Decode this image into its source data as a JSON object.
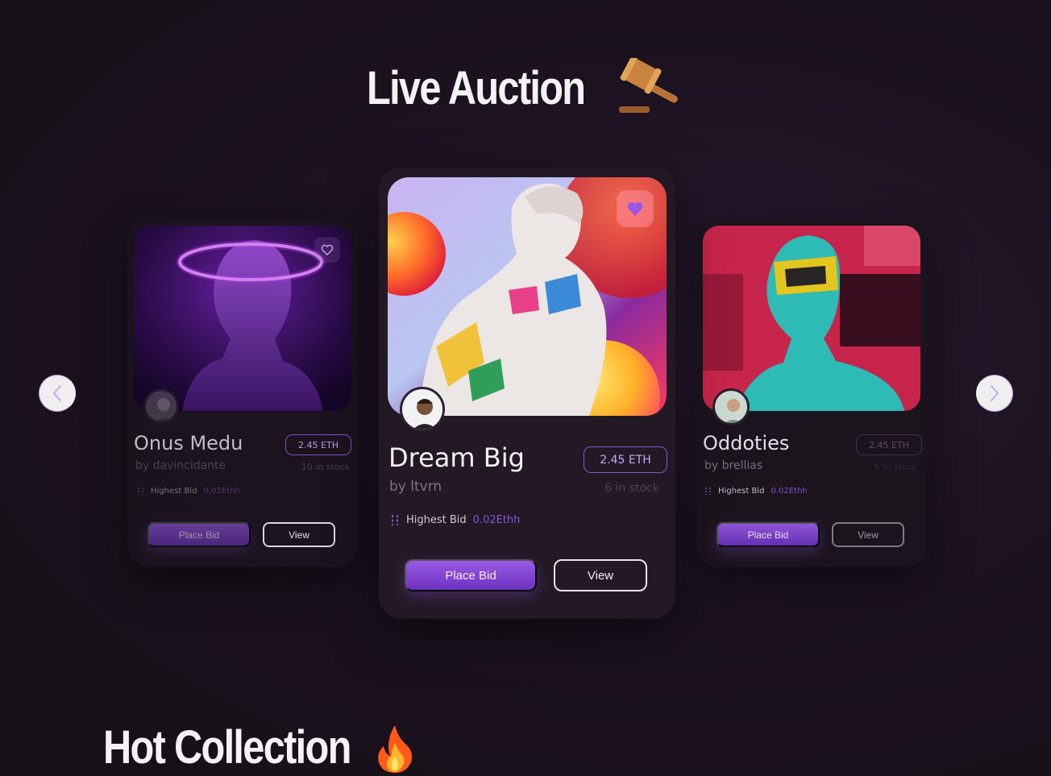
{
  "live_auction": {
    "title": "Live Auction",
    "emoji": "gavel-icon"
  },
  "hot_collection": {
    "title": "Hot Collection",
    "emoji": "fire-icon"
  },
  "carousel": {
    "prev_icon": "chevron-left-icon",
    "next_icon": "chevron-right-icon",
    "cards": [
      {
        "name": "Onus Medu",
        "author": "by davincidante",
        "price": "2.45 ETH",
        "stock": "10 in stock",
        "bid_label": "Highest Bid",
        "bid_value": "0.02Ethh",
        "place_bid": "Place Bid",
        "view": "View"
      },
      {
        "name": "Dream Big",
        "author": "by ltvrn",
        "price": "2.45 ETH",
        "stock": "6 in stock",
        "bid_label": "Highest Bid",
        "bid_value": "0.02Ethh",
        "place_bid": "Place Bid",
        "view": "View"
      },
      {
        "name": "Oddoties",
        "author": "by brellias",
        "price": "2.45 ETH",
        "stock": "6 in stock",
        "bid_label": "Highest Bid",
        "bid_value": "0.02Ethh",
        "place_bid": "Place Bid",
        "view": "View"
      }
    ]
  },
  "colors": {
    "accent": "#8c52d8",
    "background": "#1c1220",
    "card": "#221925"
  }
}
